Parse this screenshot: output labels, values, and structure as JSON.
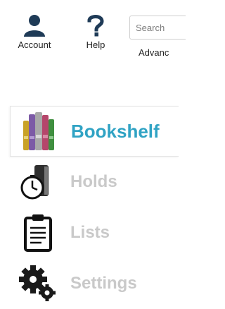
{
  "header": {
    "account_label": "Account",
    "help_label": "Help",
    "search_placeholder": "Search",
    "advanced_label": "Advanc"
  },
  "nav": {
    "items": [
      {
        "label": "Bookshelf",
        "icon": "books-icon",
        "active": true
      },
      {
        "label": "Holds",
        "icon": "hold-clock-icon",
        "active": false
      },
      {
        "label": "Lists",
        "icon": "clipboard-list-icon",
        "active": false
      },
      {
        "label": "Settings",
        "icon": "gears-icon",
        "active": false
      }
    ]
  },
  "colors": {
    "accent": "#30a3c4",
    "inactive_label": "#c9c9c9",
    "icon_dark": "#1f3b57"
  }
}
